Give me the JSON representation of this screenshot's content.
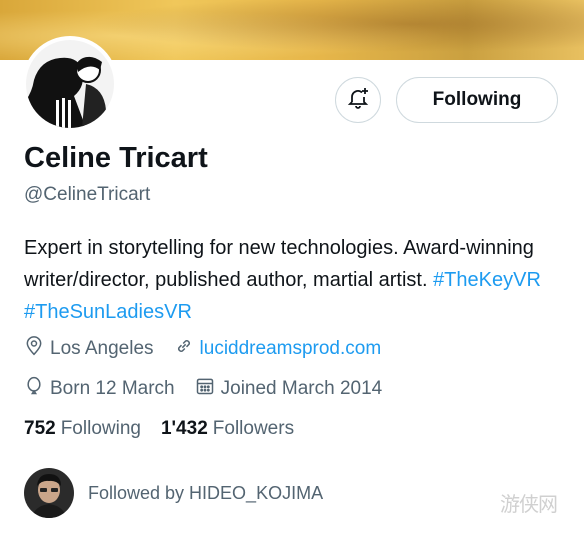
{
  "profile": {
    "name": "Celine Tricart",
    "handle": "@CelineTricart",
    "bio_text": "Expert in storytelling for new technologies. Award-winning writer/director, published author, martial artist. ",
    "bio_tags": [
      "#TheKeyVR",
      "#TheSunLadiesVR"
    ],
    "location": "Los Angeles",
    "website": "luciddreamsprod.com",
    "birthday": "Born 12 March",
    "joined": "Joined March 2014"
  },
  "actions": {
    "following_label": "Following",
    "notify_icon": "bell-plus-icon"
  },
  "stats": {
    "following_count": "752",
    "following_label": "Following",
    "followers_count": "1'432",
    "followers_label": "Followers"
  },
  "followed_by": {
    "text": "Followed by HIDEO_KOJIMA"
  },
  "watermark": "游侠网",
  "colors": {
    "link": "#1d9bf0",
    "secondary_text": "#536471",
    "primary_text": "#0f1419",
    "border": "#cfd9de"
  }
}
